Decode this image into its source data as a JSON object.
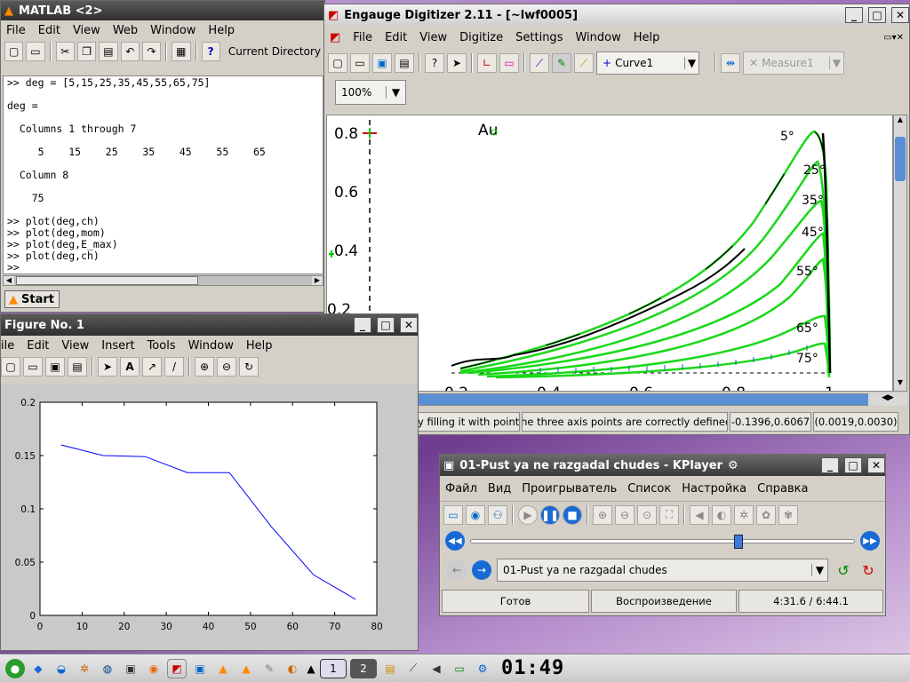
{
  "matlab": {
    "title": "MATLAB <2>",
    "menu": [
      "File",
      "Edit",
      "View",
      "Web",
      "Window",
      "Help"
    ],
    "current_dir_label": "Current Directory",
    "console_lines": [
      ">> deg = [5,15,25,35,45,55,65,75]",
      "",
      "deg =",
      "",
      "  Columns 1 through 7",
      "",
      "     5    15    25    35    45    55    65",
      "",
      "  Column 8",
      "",
      "    75",
      "",
      ">> plot(deg,ch)",
      ">> plot(deg,mom)",
      ">> plot(deg,E_max)",
      ">> plot(deg,ch)",
      ">>"
    ],
    "start_label": "Start"
  },
  "figure": {
    "title": "Figure No. 1",
    "menu": [
      "ile",
      "Edit",
      "View",
      "Insert",
      "Tools",
      "Window",
      "Help"
    ]
  },
  "engauge": {
    "title": "Engauge Digitizer 2.11 - [~lwf0005]",
    "menu": [
      "File",
      "Edit",
      "View",
      "Digitize",
      "Settings",
      "Window",
      "Help"
    ],
    "curve_select": "Curve1",
    "measure_select": "Measure1",
    "zoom": "100%",
    "plot_label": "Au",
    "y_ticks": [
      "0.8",
      "0.6",
      "0.4",
      "0.2"
    ],
    "x_ticks": [
      "0.2",
      "0.4",
      "0.6",
      "0.8",
      "1"
    ],
    "angle_labels": [
      "5°",
      "25°",
      "35°",
      "45°",
      "55°",
      "65°",
      "75°"
    ],
    "status_left": "y filling it with points...",
    "status_mid": "The three axis points are correctly defined.",
    "status_coord1": "(-0.1396,0.6067)",
    "status_coord2": "(0.0019,0.0030)"
  },
  "kplayer": {
    "title": "01-Pust ya ne razgadal chudes - KPlayer",
    "menu": [
      "Файл",
      "Вид",
      "Проигрыватель",
      "Список",
      "Настройка",
      "Справка"
    ],
    "track": "01-Pust ya ne razgadal chudes",
    "progress": 0.686,
    "status_ready": "Готов",
    "status_playing": "Воспроизведение",
    "status_time": "4:31.6 / 6:44.1"
  },
  "taskbar": {
    "desktop_num": "2",
    "clock": "01:49"
  },
  "chart_data": {
    "type": "line",
    "x": [
      5,
      15,
      25,
      35,
      45,
      55,
      65,
      75
    ],
    "series": [
      {
        "values": [
          0.16,
          0.15,
          0.149,
          0.134,
          0.134,
          0.083,
          0.038,
          0.015
        ]
      }
    ],
    "xlim": [
      0,
      80
    ],
    "ylim": [
      0,
      0.2
    ],
    "x_ticks": [
      "0",
      "10",
      "20",
      "30",
      "40",
      "50",
      "60",
      "70",
      "80"
    ],
    "y_ticks": [
      "0",
      "0.05",
      "0.1",
      "0.15",
      "0.2"
    ],
    "line_color": "#0000ff"
  }
}
